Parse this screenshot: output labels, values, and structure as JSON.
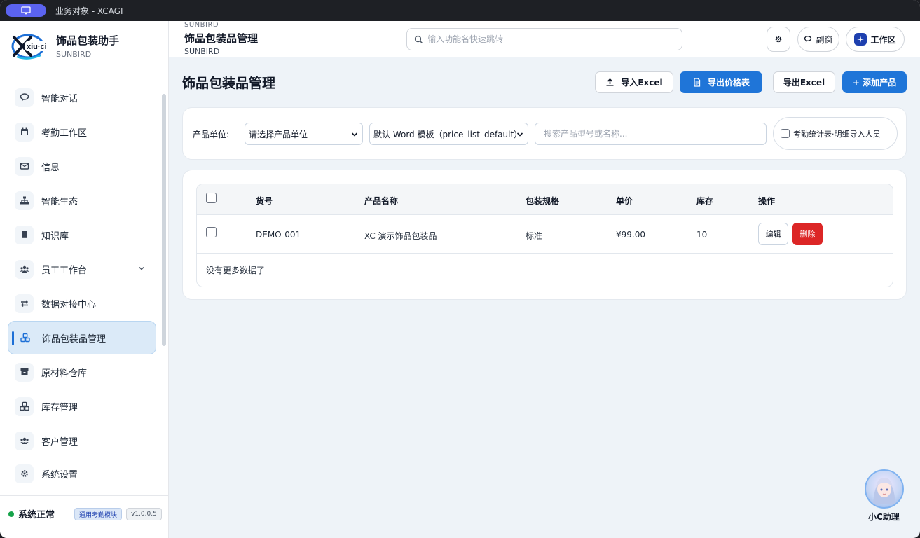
{
  "system_bar": {
    "title": "业务对象 - XCAGI"
  },
  "brand": {
    "name": "饰品包装助手",
    "sub": "SUNBIRD"
  },
  "sidebar": {
    "items": [
      {
        "label": "智能对话",
        "icon": "chat-icon"
      },
      {
        "label": "考勤工作区",
        "icon": "calendar-icon"
      },
      {
        "label": "信息",
        "icon": "mail-icon"
      },
      {
        "label": "智能生态",
        "icon": "sitemap-icon"
      },
      {
        "label": "知识库",
        "icon": "book-icon"
      },
      {
        "label": "员工工作台",
        "icon": "users-icon"
      },
      {
        "label": "数据对接中心",
        "icon": "exchange-icon"
      },
      {
        "label": "饰品包装品管理",
        "icon": "boxes-icon"
      },
      {
        "label": "原材料仓库",
        "icon": "archive-icon"
      },
      {
        "label": "库存管理",
        "icon": "boxes-icon"
      },
      {
        "label": "客户管理",
        "icon": "users-icon"
      }
    ],
    "settings_label": "系统设置",
    "status_text": "系统正常",
    "module_badge": "通用考勤模块",
    "version": "v1.0.0.5"
  },
  "header": {
    "small": "SUNBIRD",
    "title": "饰品包装品管理",
    "sub": "SUNBIRD",
    "search_placeholder": "输入功能名快速跳转",
    "sub_window_label": "副窗",
    "workspace_label": "工作区"
  },
  "main": {
    "page_title": "饰品包装品管理",
    "actions": {
      "import_excel": "导入Excel",
      "export_price": "导出价格表",
      "export_excel": "导出Excel",
      "add_product": "+ 添加产品"
    },
    "filter": {
      "unit_label": "产品单位:",
      "unit_value": "请选择产品单位",
      "template_value": "默认 Word 模板（price_list_default）",
      "search_placeholder": "搜索产品型号或名称...",
      "checkbox_label": "考勤统计表·明细导入人员"
    },
    "table": {
      "columns": [
        "货号",
        "产品名称",
        "包装规格",
        "单价",
        "库存",
        "操作"
      ],
      "rows": [
        {
          "sku": "DEMO-001",
          "name": "XC 演示饰品包装品",
          "spec": "标准",
          "price": "¥99.00",
          "stock": "10",
          "edit": "编辑",
          "delete": "删除"
        }
      ],
      "empty_text": "没有更多数据了"
    }
  },
  "assistant": {
    "label": "小C助理"
  }
}
